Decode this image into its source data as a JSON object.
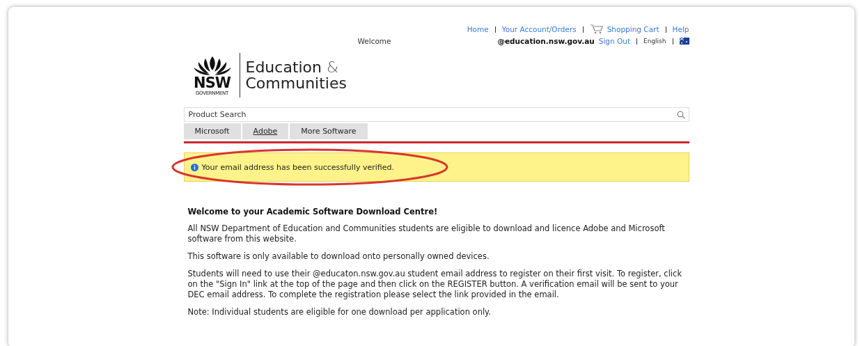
{
  "top_links": [
    {
      "label": "Home",
      "kind": "link"
    },
    {
      "label": "Your Account/Orders",
      "kind": "link"
    },
    {
      "label": "Shopping Cart",
      "kind": "cart"
    },
    {
      "label": "Help",
      "kind": "link"
    }
  ],
  "welcome": "Welcome",
  "user_email": "@education.nsw.gov.au",
  "sign_out": "Sign Out",
  "language": "English",
  "logo": {
    "mark": "NSW",
    "sub": "GOVERNMENT",
    "line_1": "Education",
    "amp": "&",
    "line_2": "Communities"
  },
  "search": {
    "placeholder": "Product Search"
  },
  "tabs": [
    {
      "label": "Microsoft",
      "selected": false
    },
    {
      "label": "Adobe",
      "selected": true
    },
    {
      "label": "More Software",
      "selected": false
    }
  ],
  "notice": {
    "text": "Your email address has been successfully verified.",
    "highlighted": true
  },
  "heading": "Welcome to your Academic Software Download Centre!",
  "paragraphs": [
    "All NSW Department of Education and Communities students are eligible to download and licence Adobe and Microsoft software from this website.",
    "This software is only available to download onto personally owned devices.",
    "Students will need to use their @educaton.nsw.gov.au student email address to register on their first visit. To register, click on the \"Sign In\" link at the top of the page and then click on the REGISTER button. A verification email will be sent to your DEC email address. To complete the registration please select the link provided in the email.",
    "Note: Individual students are eligible for one download per application only."
  ]
}
